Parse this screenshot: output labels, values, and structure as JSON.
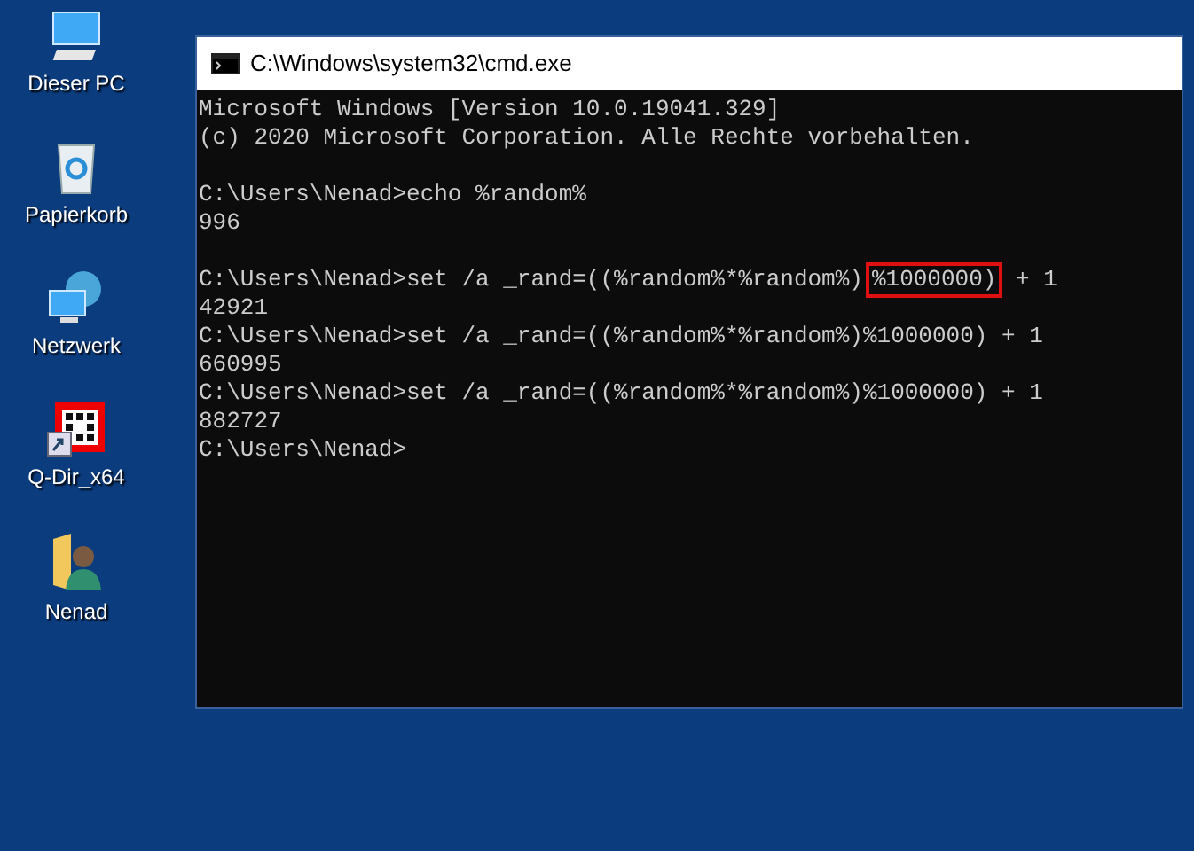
{
  "desktop_icons": [
    {
      "kind": "pc",
      "label": "Dieser PC"
    },
    {
      "kind": "bin",
      "label": "Papierkorb"
    },
    {
      "kind": "network",
      "label": "Netzwerk"
    },
    {
      "kind": "app",
      "label": "Q-Dir_x64"
    },
    {
      "kind": "user",
      "label": "Nenad"
    }
  ],
  "window": {
    "title": "C:\\Windows\\system32\\cmd.exe"
  },
  "console_blocks": [
    {
      "lines": [
        {
          "parts": [
            {
              "text": "Microsoft Windows [Version 10.0.19041.329]",
              "highlighted": false
            }
          ]
        },
        {
          "parts": [
            {
              "text": "(c) 2020 Microsoft Corporation. Alle Rechte vorbehalten.",
              "highlighted": false
            }
          ]
        }
      ]
    },
    {
      "lines": [
        {
          "parts": [
            {
              "text": "C:\\Users\\Nenad>echo %random%",
              "highlighted": false
            }
          ]
        },
        {
          "parts": [
            {
              "text": "996",
              "highlighted": false
            }
          ]
        }
      ]
    },
    {
      "lines": [
        {
          "parts": [
            {
              "text": "C:\\Users\\Nenad>set /a _rand=((%random%*%random%)",
              "highlighted": false
            },
            {
              "text": "%1000000)",
              "highlighted": true
            },
            {
              "text": " + 1",
              "highlighted": false
            }
          ]
        },
        {
          "parts": [
            {
              "text": "42921",
              "highlighted": false
            }
          ]
        },
        {
          "parts": [
            {
              "text": "C:\\Users\\Nenad>set /a _rand=((%random%*%random%)%1000000) + 1",
              "highlighted": false
            }
          ]
        },
        {
          "parts": [
            {
              "text": "660995",
              "highlighted": false
            }
          ]
        },
        {
          "parts": [
            {
              "text": "C:\\Users\\Nenad>set /a _rand=((%random%*%random%)%1000000) + 1",
              "highlighted": false
            }
          ]
        },
        {
          "parts": [
            {
              "text": "882727",
              "highlighted": false
            }
          ]
        },
        {
          "parts": [
            {
              "text": "C:\\Users\\Nenad>",
              "highlighted": false
            }
          ]
        }
      ]
    }
  ]
}
